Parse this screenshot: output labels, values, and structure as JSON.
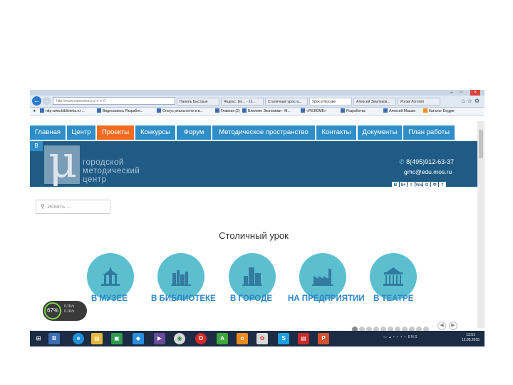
{
  "browser": {
    "tabs": [
      {
        "label": "Панель Быстрые"
      },
      {
        "label": "Яндекс: bin... - 22..."
      },
      {
        "label": "Сталичный урок.ru..."
      },
      {
        "label": "Урок в Москве",
        "active": true
      },
      {
        "label": "Алексей Земляков..."
      },
      {
        "label": "Ролик Логотип"
      }
    ],
    "favorites": [
      "http-www.biblioteka.ru-...",
      "Видеозапись Разработ...",
      "Статус реальности и в...",
      "Главная (2)",
      "Влияние Экономики - М...",
      "«РЕЗЮМЕ»",
      "Разработка",
      "Алексей Машин",
      "Каталог Dogger"
    ]
  },
  "site": {
    "nav": [
      "Главная",
      "Центр",
      "Проекты",
      "Конкурсы",
      "Форум",
      "Методическое пространство",
      "Контакты",
      "Документы",
      "План работы"
    ],
    "nav_active": "Проекты",
    "nav_second_row": "В",
    "logo_symbol": "μ",
    "logo_lines": [
      "городской",
      "методический",
      "центр"
    ],
    "phone": "8(495)912-63-37",
    "email": "gmc@edu.mos.ru",
    "social": [
      "В",
      "8+",
      "t",
      "You",
      "О",
      "Ф",
      "f"
    ],
    "search_placeholder": "искать ...",
    "page_title": "Столичный урок",
    "categories": [
      {
        "label": "В МУЗЕЕ",
        "icon": "museum-icon"
      },
      {
        "label": "В БИБЛИОТЕКЕ",
        "icon": "books-icon"
      },
      {
        "label": "В ГОРОДЕ",
        "icon": "city-icon"
      },
      {
        "label": "НА ПРЕДПРИЯТИИ",
        "icon": "factory-icon"
      },
      {
        "label": "В ТЕАТРЕ",
        "icon": "theatre-icon"
      }
    ]
  },
  "widget": {
    "percent": "67%",
    "line1": "0.1K/s",
    "line2": "0.1K/s"
  },
  "taskbar": {
    "apps": [
      "windows",
      "В",
      "e",
      "folder",
      "store",
      "dropbox",
      "media",
      "chrome",
      "opera",
      "А",
      "ok",
      "yandex",
      "skype",
      "adobe",
      "ppt"
    ],
    "tray_lang": "ENG",
    "time": "13:51",
    "date": "12.05.2015"
  },
  "colors": {
    "nav_blue": "#2f8ec7",
    "nav_active": "#f26b21",
    "banner": "#1f5b84",
    "circle": "#5bbfd0",
    "label": "#2d86c6"
  }
}
